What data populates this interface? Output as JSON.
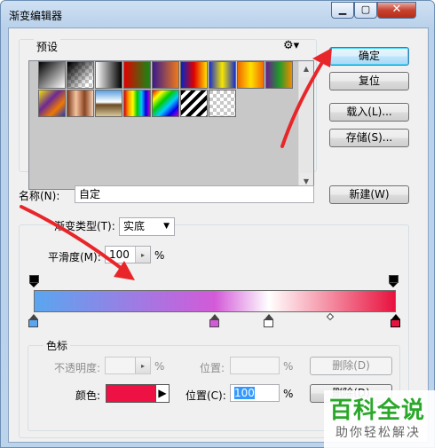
{
  "window": {
    "title": "渐变编辑器"
  },
  "presets": {
    "label": "预设",
    "menu_icon": "gear-icon",
    "swatches": [
      {
        "name": "black-to-white",
        "bg": "linear-gradient(135deg,#000,#fff)"
      },
      {
        "name": "black-transparent",
        "bg": "linear-gradient(135deg,#000 10%,rgba(0,0,0,0) 90%)"
      },
      {
        "name": "white-black",
        "bg": "linear-gradient(90deg,#fff,#000)"
      },
      {
        "name": "red-green",
        "bg": "linear-gradient(90deg,#e30000,#138a13)"
      },
      {
        "name": "violet-orange",
        "bg": "linear-gradient(90deg,#3b1a8c,#f07a18)"
      },
      {
        "name": "blue-red-yellow",
        "bg": "linear-gradient(90deg,#0025c8,#e10000,#ffe100)"
      },
      {
        "name": "blue-yellow-blue",
        "bg": "linear-gradient(90deg,#1c2fc8,#f5e600,#1c2fc8)"
      },
      {
        "name": "orange-yellow-orange",
        "bg": "linear-gradient(90deg,#f06a00,#ffe000,#f06a00)"
      },
      {
        "name": "violet-green-orange",
        "bg": "linear-gradient(90deg,#6a1d8f,#1f9a2a,#f38b00)"
      },
      {
        "name": "yellow-violet-orange-blue",
        "bg": "linear-gradient(135deg,#f2e200,#6b2a94 40%,#f07800 70%,#1d3ac2)"
      },
      {
        "name": "copper",
        "bg": "linear-gradient(90deg,#7a3b1d,#f5c2a0,#8a4420,#f5d0b4)"
      },
      {
        "name": "chrome",
        "bg": "linear-gradient(180deg,#5aa0e0,#fff 45%,#6b4a24 55%,#d8c79a)"
      },
      {
        "name": "spectrum",
        "bg": "linear-gradient(90deg,#e00000,#ff9c00,#ffff00,#00c800,#00c8ff,#0000e0,#c800c8)"
      },
      {
        "name": "rainbow-transparent",
        "bg": "linear-gradient(135deg,#e00,#ff0,#0c0,#0cf,#00e,#c0c)"
      },
      {
        "name": "stripes",
        "bg": "repeating-linear-gradient(135deg,#000 0 4px,#fff 4px 8px)"
      },
      {
        "name": "transparent-stripes",
        "bg": "repeating-linear-gradient(135deg,rgba(0,0,0,0.15) 0 4px,rgba(255,255,255,0.6) 4px 8px)"
      }
    ]
  },
  "buttons": {
    "ok": "确定",
    "reset": "复位",
    "load": "载入(L)...",
    "save": "存储(S)...",
    "new": "新建(W)",
    "delete_opacity": "删除(D)",
    "delete_color": "删除(D)"
  },
  "name_field": {
    "label": "名称(N):",
    "value": "自定"
  },
  "gradient_type": {
    "label": "渐变类型(T):",
    "value": "实底"
  },
  "smoothness": {
    "label": "平滑度(M):",
    "value": "100",
    "unit": "%"
  },
  "gradient": {
    "stops": [
      {
        "position": 0,
        "color": "#5aa6f0"
      },
      {
        "position": 50,
        "color": "#d35ad8"
      },
      {
        "position": 65,
        "color": "#ffffff"
      },
      {
        "position": 100,
        "color": "#e8123e"
      }
    ]
  },
  "color_stops": {
    "group_label": "色标",
    "opacity_label": "不透明度:",
    "opacity_unit": "%",
    "opacity_location_label": "位置:",
    "opacity_location_unit": "%",
    "color_label": "颜色:",
    "color_value": "#ee1144",
    "color_location_label": "位置(C):",
    "color_location_value": "100",
    "color_location_unit": "%"
  },
  "watermark": {
    "main": "百科全说",
    "sub": "助你轻松解决"
  }
}
